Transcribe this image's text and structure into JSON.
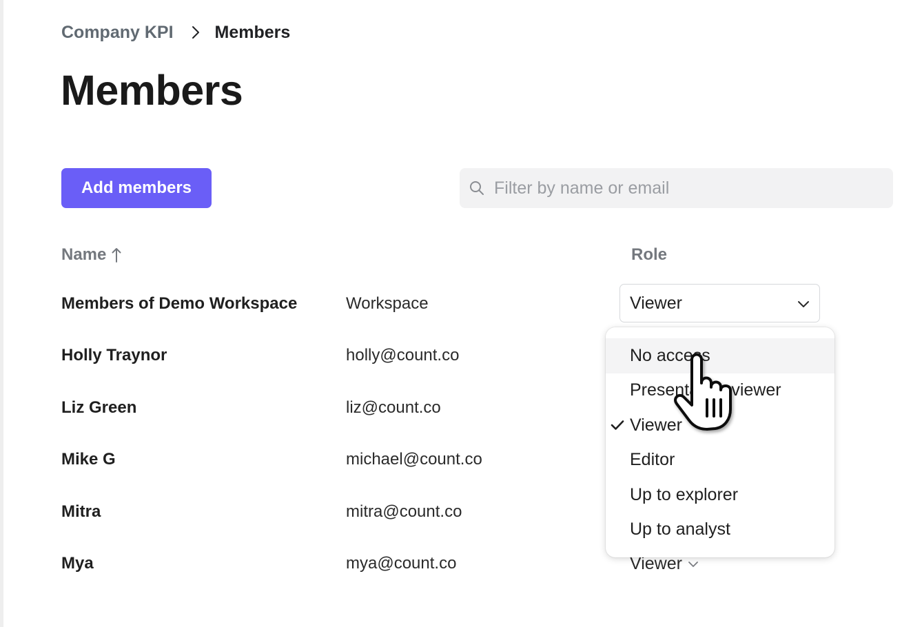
{
  "breadcrumb": {
    "parent": "Company KPI",
    "current": "Members"
  },
  "page": {
    "title": "Members"
  },
  "toolbar": {
    "add_members_label": "Add members"
  },
  "search": {
    "placeholder": "Filter by name or email",
    "value": ""
  },
  "table": {
    "headers": {
      "name": "Name",
      "sort_indicator": "↑",
      "role": "Role"
    },
    "rows": [
      {
        "name": "Members of Demo Workspace",
        "email": "Workspace",
        "role": "Viewer"
      },
      {
        "name": "Holly Traynor",
        "email": "holly@count.co"
      },
      {
        "name": "Liz Green",
        "email": "liz@count.co"
      },
      {
        "name": "Mike G",
        "email": "michael@count.co"
      },
      {
        "name": "Mitra",
        "email": "mitra@count.co"
      },
      {
        "name": "Mya",
        "email": "mya@count.co",
        "role": "Viewer"
      }
    ]
  },
  "role_menu": {
    "selected": "Viewer",
    "hovered": "No access",
    "options": [
      "No access",
      "Presentation viewer",
      "Viewer",
      "Editor",
      "Up to explorer",
      "Up to analyst"
    ]
  },
  "colors": {
    "accent": "#6a5ef7",
    "muted_text": "#74787e",
    "search_bg": "#f2f2f3"
  },
  "icons": {
    "breadcrumb_separator": "chevron-right-icon",
    "search": "search-icon",
    "sort": "arrow-up-icon",
    "dropdown": "chevron-down-icon",
    "selected": "check-icon",
    "cursor": "hand-pointer-icon"
  }
}
